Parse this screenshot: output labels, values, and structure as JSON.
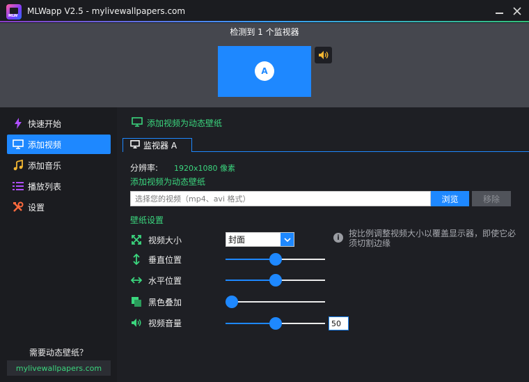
{
  "titlebar": {
    "title": "MLWapp V2.5 - mylivewallpapers.com",
    "logo_text": "MLW"
  },
  "monitors": {
    "detected_text": "检测到 1 个监视器",
    "badge": "A"
  },
  "sidebar": {
    "items": [
      {
        "label": "快速开始",
        "icon": "lightning-icon",
        "active": false
      },
      {
        "label": "添加视频",
        "icon": "monitor-icon",
        "active": true
      },
      {
        "label": "添加音乐",
        "icon": "music-note-icon",
        "active": false
      },
      {
        "label": "播放列表",
        "icon": "playlist-icon",
        "active": false
      },
      {
        "label": "设置",
        "icon": "tools-icon",
        "active": false
      }
    ],
    "need_text": "需要动态壁纸？",
    "site_link": "mylivewallpapers.com"
  },
  "main": {
    "heading": "添加视频为动态壁纸",
    "tab_label": "监视器 A",
    "resolution_label": "分辨率:",
    "resolution_value": "1920x1080 像素",
    "add_video_label": "添加视频为动态壁纸",
    "file_placeholder": "选择您的视频（mp4、avi 格式）",
    "browse_label": "浏览",
    "remove_label": "移除",
    "settings_heading": "壁纸设置",
    "settings": {
      "video_size": {
        "label": "视频大小",
        "value": "封面"
      },
      "vertical_position": {
        "label": "垂直位置",
        "value": 0.5
      },
      "horizontal_position": {
        "label": "水平位置",
        "value": 0.5
      },
      "black_overlay": {
        "label": "黑色叠加",
        "value": 0.0
      },
      "video_volume": {
        "label": "视频音量",
        "value": 0.5,
        "number": "50"
      }
    },
    "info_text": "按比例调整视频大小以覆盖显示器，即使它必须切割边缘"
  },
  "colors": {
    "accent": "#1e88ff",
    "green": "#3bd67e",
    "background": "#1e1f24"
  }
}
